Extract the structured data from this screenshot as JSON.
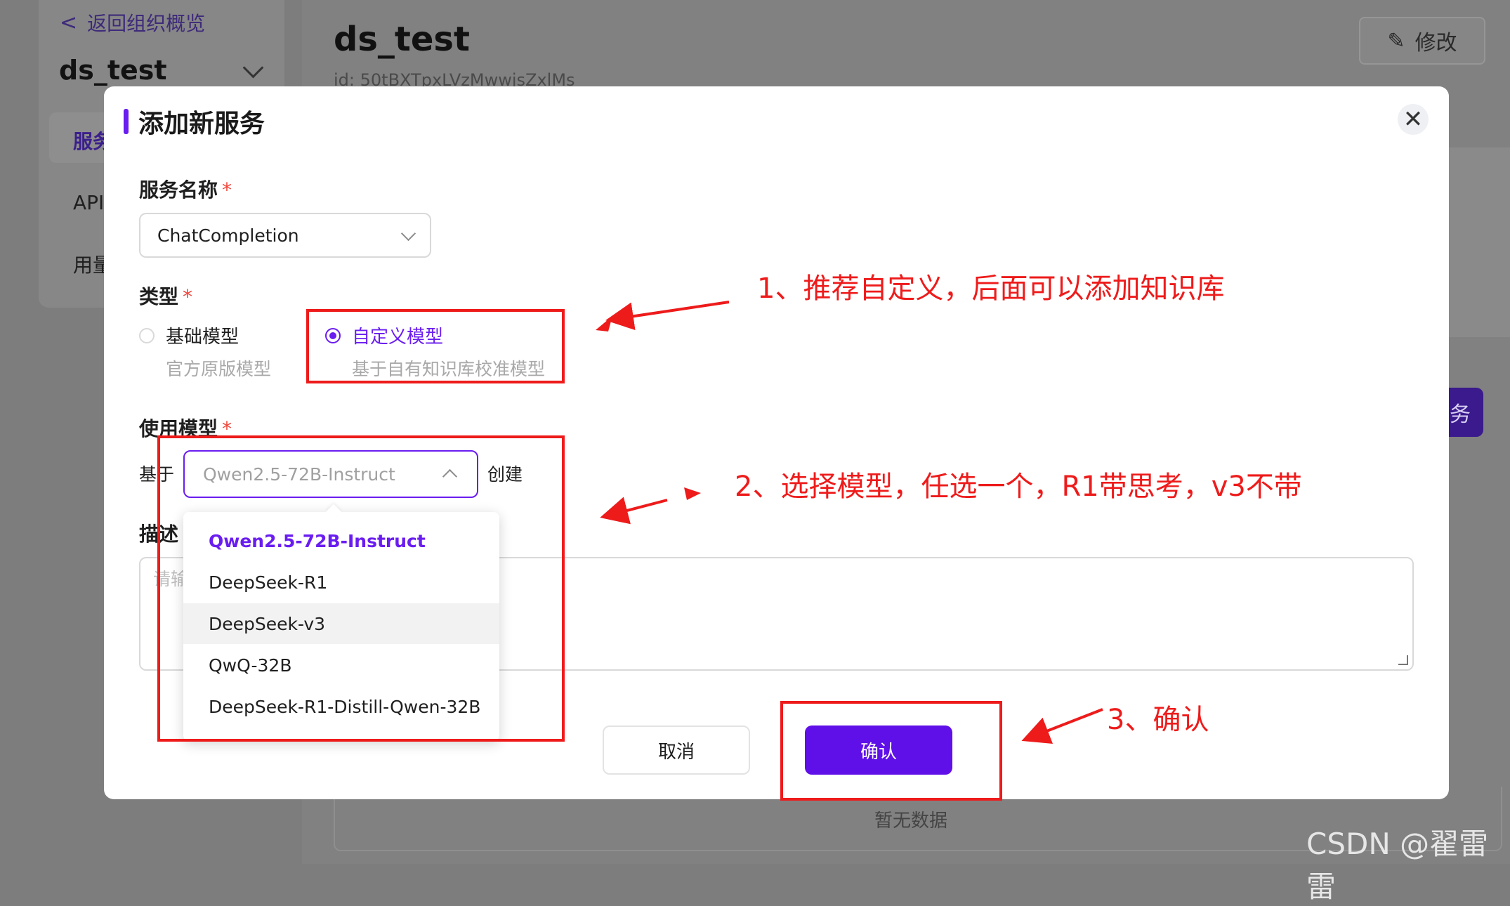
{
  "background": {
    "back_link": "返回组织概览",
    "org_name": "ds_test",
    "nav_items": [
      "服务",
      "API",
      "用量"
    ],
    "page_title": "ds_test",
    "page_id": "id: 50tBXTpxLVzMwwjsZxlMs",
    "edit_button": "修改",
    "side_button_fragment": "务",
    "empty_text": "暂无数据"
  },
  "modal": {
    "title": "添加新服务",
    "close_icon": "close-icon",
    "service_name": {
      "label": "服务名称",
      "required_mark": "*",
      "value": "ChatCompletion"
    },
    "type": {
      "label": "类型",
      "required_mark": "*",
      "options": [
        {
          "title": "基础模型",
          "subtitle": "官方原版模型",
          "selected": false
        },
        {
          "title": "自定义模型",
          "subtitle": "基于自有知识库校准模型",
          "selected": true
        }
      ]
    },
    "model": {
      "label": "使用模型",
      "required_mark": "*",
      "prefix": "基于",
      "placeholder": "Qwen2.5-72B-Instruct",
      "suffix": "创建",
      "options": [
        "Qwen2.5-72B-Instruct",
        "DeepSeek-R1",
        "DeepSeek-v3",
        "QwQ-32B",
        "DeepSeek-R1-Distill-Qwen-32B"
      ],
      "selected": "Qwen2.5-72B-Instruct",
      "hovered": "DeepSeek-v3"
    },
    "description": {
      "label": "描述",
      "placeholder": "请输"
    },
    "cancel_button": "取消",
    "confirm_button": "确认"
  },
  "annotations": [
    "1、推荐自定义，后面可以添加知识库",
    "2、选择模型，任选一个，R1带思考，v3不带",
    "3、确认"
  ],
  "watermark": "CSDN @翟雷雷",
  "colors": {
    "accent": "#6a1df0",
    "confirm": "#5f0fe8",
    "annotation_red": "#ee1b1b",
    "required": "#f0453a"
  }
}
